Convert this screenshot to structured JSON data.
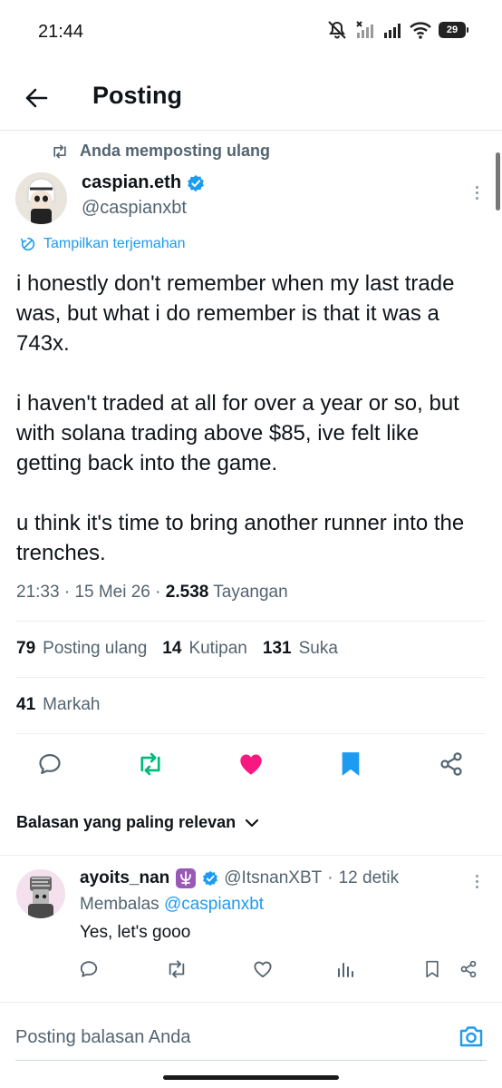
{
  "status_bar": {
    "time": "21:44",
    "battery": "29",
    "icons": [
      "mute-icon",
      "signal-off-icon",
      "signal-icon",
      "wifi-icon",
      "battery-icon"
    ]
  },
  "header": {
    "back_icon": "arrow-left-icon",
    "title": "Posting"
  },
  "tweet": {
    "repost_label": "Anda memposting ulang",
    "author": {
      "name": "caspian.eth",
      "handle": "@caspianxbt",
      "verified": true
    },
    "translate_label": "Tampilkan terjemahan",
    "body": [
      "i honestly don't remember when my last trade was, but what i do remember is that it was a 743x.",
      "i haven't traded at all for over a year or so, but with solana trading above $85, ive felt like getting back into the game.",
      "u think it's time to bring another runner into the trenches."
    ],
    "meta": {
      "time": "21:33",
      "sep1": "·",
      "date": "15 Mei 26",
      "sep2": "·",
      "views": "2.538",
      "views_label": "Tayangan"
    },
    "stats": {
      "reposts": "79",
      "reposts_label": "Posting ulang",
      "quotes": "14",
      "quotes_label": "Kutipan",
      "likes": "131",
      "likes_label": "Suka",
      "bookmarks": "41",
      "bookmarks_label": "Markah"
    },
    "actions": [
      "reply-icon",
      "repost-icon",
      "like-icon",
      "bookmark-icon",
      "share-icon"
    ],
    "colors": {
      "repost_active": "#00ba7c",
      "like_active": "#f91880",
      "bookmark_active": "#1d9bf0",
      "link": "#1d9bf0",
      "verified": "#1d9bf0"
    }
  },
  "replies": {
    "sort_label": "Balasan yang paling relevan",
    "items": [
      {
        "name": "ayoits_nan",
        "handle": "@ItsnanXBT",
        "sep": "·",
        "time": "12 detik",
        "replying_prefix": "Membalas",
        "replying_to": "@caspianxbt",
        "text": "Yes, let's gooo"
      }
    ]
  },
  "compose": {
    "placeholder": "Posting balasan Anda"
  }
}
